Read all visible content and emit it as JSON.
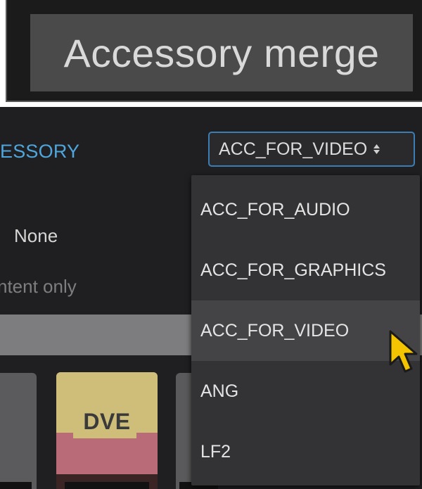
{
  "title": {
    "text": "Accessory merge"
  },
  "panel": {
    "accessory_label": "ESSORY",
    "select": {
      "value": "ACC_FOR_VIDEO",
      "arrows": "◆"
    },
    "none_label": "None",
    "content_only_label": "ntent only",
    "tiles": {
      "dve_label": "DVE"
    }
  },
  "dropdown": {
    "items": [
      {
        "label": "ACC_FOR_AUDIO"
      },
      {
        "label": "ACC_FOR_GRAPHICS"
      },
      {
        "label": "ACC_FOR_VIDEO",
        "selected": true
      },
      {
        "label": "ANG"
      },
      {
        "label": "LF2"
      }
    ]
  },
  "colors": {
    "accent_blue": "#4ea6dd",
    "dve_yellow": "#cfbd7a",
    "dve_pink": "#b96b78",
    "cursor_yellow": "#f5c400"
  }
}
